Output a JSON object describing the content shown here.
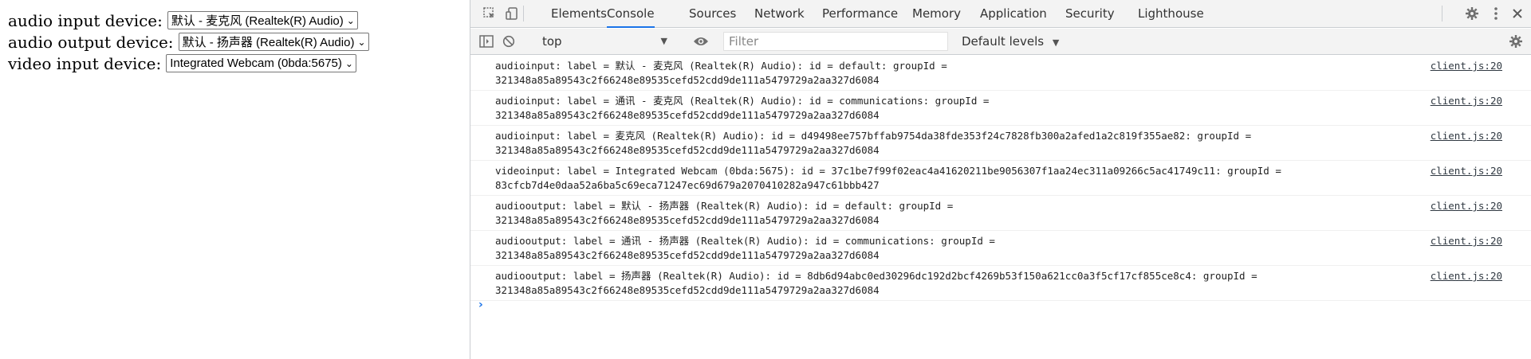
{
  "page": {
    "rows": [
      {
        "label": "audio input device:",
        "selected": "默认 - 麦克风 (Realtek(R) Audio)"
      },
      {
        "label": "audio output device:",
        "selected": "默认 - 扬声器 (Realtek(R) Audio)"
      },
      {
        "label": "video input device:",
        "selected": "Integrated Webcam (0bda:5675)"
      }
    ]
  },
  "devtools": {
    "tabs": [
      "Elements",
      "Console",
      "Sources",
      "Network",
      "Performance",
      "Memory",
      "Application",
      "Security",
      "Lighthouse"
    ],
    "active_tab": "Console",
    "toolbar": {
      "context": "top",
      "filter_placeholder": "Filter",
      "levels": "Default levels"
    },
    "messages": [
      {
        "text": "audioinput: label = 默认 - 麦克风 (Realtek(R) Audio): id = default: groupId =\n321348a85a89543c2f66248e89535cefd52cdd9de111a5479729a2aa327d6084",
        "source": "client.js:20"
      },
      {
        "text": "audioinput: label = 通讯 - 麦克风 (Realtek(R) Audio): id = communications: groupId =\n321348a85a89543c2f66248e89535cefd52cdd9de111a5479729a2aa327d6084",
        "source": "client.js:20"
      },
      {
        "text": "audioinput: label = 麦克风 (Realtek(R) Audio): id = d49498ee757bffab9754da38fde353f24c7828fb300a2afed1a2c819f355ae82: groupId =\n321348a85a89543c2f66248e89535cefd52cdd9de111a5479729a2aa327d6084",
        "source": "client.js:20"
      },
      {
        "text": "videoinput: label = Integrated Webcam (0bda:5675): id = 37c1be7f99f02eac4a41620211be9056307f1aa24ec311a09266c5ac41749c11: groupId =\n83cfcb7d4e0daa52a6ba5c69eca71247ec69d679a2070410282a947c61bbb427",
        "source": "client.js:20"
      },
      {
        "text": "audiooutput: label = 默认 - 扬声器 (Realtek(R) Audio): id = default: groupId =\n321348a85a89543c2f66248e89535cefd52cdd9de111a5479729a2aa327d6084",
        "source": "client.js:20"
      },
      {
        "text": "audiooutput: label = 通讯 - 扬声器 (Realtek(R) Audio): id = communications: groupId =\n321348a85a89543c2f66248e89535cefd52cdd9de111a5479729a2aa327d6084",
        "source": "client.js:20"
      },
      {
        "text": "audiooutput: label = 扬声器 (Realtek(R) Audio): id = 8db6d94abc0ed30296dc192d2bcf4269b53f150a621cc0a3f5cf17cf855ce8c4: groupId =\n321348a85a89543c2f66248e89535cefd52cdd9de111a5479729a2aa327d6084",
        "source": "client.js:20"
      }
    ],
    "prompt_glyph": "›"
  }
}
